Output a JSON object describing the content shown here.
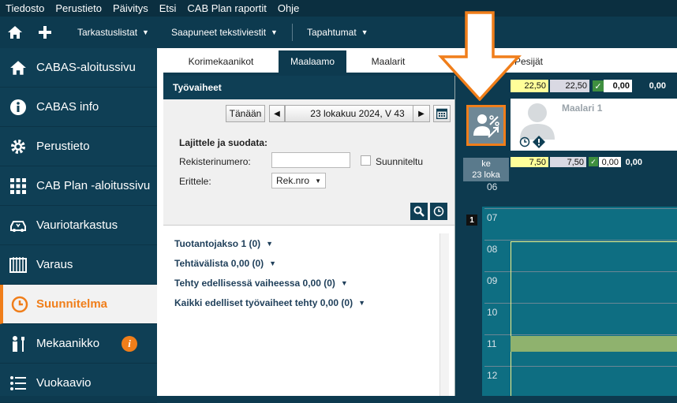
{
  "menu": [
    "Tiedosto",
    "Perustieto",
    "Päivitys",
    "Etsi",
    "CAB Plan raportit",
    "Ohje"
  ],
  "toolbar": {
    "dropdowns": [
      "Tarkastuslistat",
      "Saapuneet tekstiviestit",
      "Tapahtumat"
    ]
  },
  "sidebar": {
    "items": [
      {
        "label": "CABAS-aloitussivu",
        "icon": "home-icon"
      },
      {
        "label": "CABAS info",
        "icon": "info-icon"
      },
      {
        "label": "Perustieto",
        "icon": "gear-icon"
      },
      {
        "label": "CAB Plan -aloitussivu",
        "icon": "grid-icon"
      },
      {
        "label": "Vauriotarkastus",
        "icon": "car-damage-icon"
      },
      {
        "label": "Varaus",
        "icon": "booking-icon"
      },
      {
        "label": "Suunnitelma",
        "icon": "clock-icon",
        "active": true
      },
      {
        "label": "Mekaanikko",
        "icon": "mechanic-icon",
        "badge": "i"
      },
      {
        "label": "Vuokaavio",
        "icon": "list-icon"
      }
    ]
  },
  "tabs": [
    "Korimekaanikot",
    "Maalaamo",
    "Maalarit",
    "Pesijät"
  ],
  "active_tab": "Maalaamo",
  "panel": {
    "title": "Työvaiheet",
    "today_button": "Tänään",
    "date_label": "23 lokakuu 2024, V 43",
    "sort_filter_title": "Lajittele ja suodata:",
    "reg_label": "Rekisterinumero:",
    "reg_value": "",
    "planned_label": "Suunniteltu",
    "split_label": "Erittele:",
    "split_value": "Rek.nro",
    "links": [
      "Tuotantojakso 1 (0)",
      "Tehtävälista 0,00 (0)",
      "Tehty edellisessä vaiheessa 0,00 (0)",
      "Kaikki edelliset työvaiheet tehty 0,00 (0)"
    ]
  },
  "calendar": {
    "summary_top": {
      "planned": "22,50",
      "capacity": "22,50",
      "used": "0,00",
      "total": "0,00"
    },
    "worker_name": "Maalari 1",
    "day_label_1": "ke",
    "day_label_2": "23 loka",
    "summary_day": {
      "planned": "7,50",
      "capacity": "7,50",
      "used": "0,00",
      "total": "0,00"
    },
    "week_badge": "1",
    "hours": [
      "06",
      "07",
      "08",
      "09",
      "10",
      "11",
      "12"
    ]
  },
  "colors": {
    "accent": "#f07e1a",
    "nav": "#0f3f55",
    "highlight_yellow": "#ffff99",
    "booking_green": "#8fb26e"
  }
}
